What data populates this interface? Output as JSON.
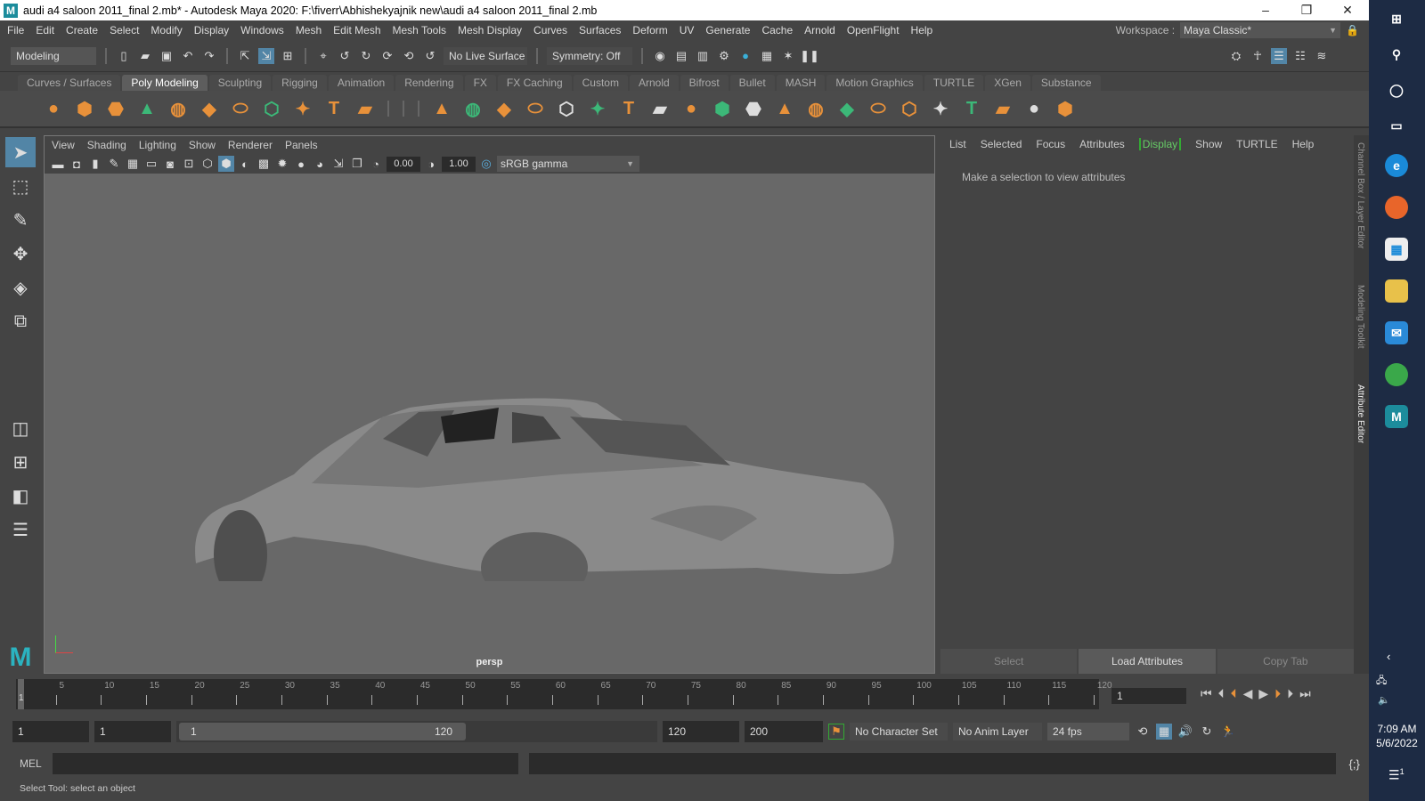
{
  "title": "audi a4 saloon 2011_final 2.mb* - Autodesk Maya 2020: F:\\fiverr\\Abhishekyajnik new\\audi a4 saloon 2011_final 2.mb",
  "window_controls": {
    "minimize": "–",
    "maximize": "❐",
    "close": "✕"
  },
  "menu": [
    "File",
    "Edit",
    "Create",
    "Select",
    "Modify",
    "Display",
    "Windows",
    "Mesh",
    "Edit Mesh",
    "Mesh Tools",
    "Mesh Display",
    "Curves",
    "Surfaces",
    "Deform",
    "UV",
    "Generate",
    "Cache",
    "Arnold",
    "OpenFlight",
    "Help"
  ],
  "workspace": {
    "label": "Workspace :",
    "value": "Maya Classic*"
  },
  "statusline": {
    "mode": "Modeling",
    "live_surface": "No Live Surface",
    "symmetry": "Symmetry: Off"
  },
  "shelf_tabs": [
    "Curves / Surfaces",
    "Poly Modeling",
    "Sculpting",
    "Rigging",
    "Animation",
    "Rendering",
    "FX",
    "FX Caching",
    "Custom",
    "Arnold",
    "Bifrost",
    "Bullet",
    "MASH",
    "Motion Graphics",
    "TURTLE",
    "XGen",
    "Substance"
  ],
  "shelf_active": "Poly Modeling",
  "shelf_icons": [
    "poly-sphere",
    "poly-cube",
    "poly-cylinder",
    "poly-cone",
    "poly-torus",
    "poly-plane",
    "poly-disc",
    "platonic-solid",
    "super-shape",
    "type",
    "svg",
    "",
    "",
    "",
    "combine",
    "separate",
    "extract",
    "smooth",
    "boolean",
    "mirror",
    "bevel",
    "bridge",
    "extrude",
    "fill-hole",
    "append",
    "multi-cut",
    "target-weld",
    "connect",
    "quad-draw",
    "uv-editor",
    "automatic-map",
    "planar-map",
    "cylindrical-map",
    "unfold",
    "layout"
  ],
  "viewport": {
    "menu": [
      "View",
      "Shading",
      "Lighting",
      "Show",
      "Renderer",
      "Panels"
    ],
    "exposure": "0.00",
    "gamma": "1.00",
    "color_space": "sRGB gamma",
    "camera": "persp"
  },
  "attribute_editor": {
    "menu": [
      "List",
      "Selected",
      "Focus",
      "Attributes",
      "Display",
      "Show",
      "TURTLE",
      "Help"
    ],
    "message": "Make a selection to view attributes",
    "buttons": [
      "Select",
      "Load Attributes",
      "Copy Tab"
    ]
  },
  "side_tabs": [
    "Channel Box / Layer Editor",
    "Modeling Toolkit",
    "Attribute Editor"
  ],
  "timeline": {
    "start": 1,
    "end": 120,
    "ticks": [
      5,
      10,
      15,
      20,
      25,
      30,
      35,
      40,
      45,
      50,
      55,
      60,
      65,
      70,
      75,
      80,
      85,
      90,
      95,
      100,
      105,
      110,
      115,
      120
    ],
    "current_frame_marker": "1",
    "current_frame": "1"
  },
  "range": {
    "start": "1",
    "playback_start": "1",
    "slider_start": "1",
    "slider_end": "120",
    "playback_end": "120",
    "end": "200",
    "character_set": "No Character Set",
    "anim_layer": "No Anim Layer",
    "fps": "24 fps"
  },
  "command_line": {
    "label": "MEL"
  },
  "help_line": "Select Tool: select an object",
  "taskbar": {
    "time": "7:09 AM",
    "date": "5/6/2022",
    "notifications": "1"
  },
  "colors": {
    "accent": "#5285a6",
    "shelf_orange": "#e8913a",
    "display_green": "#66cc66"
  }
}
